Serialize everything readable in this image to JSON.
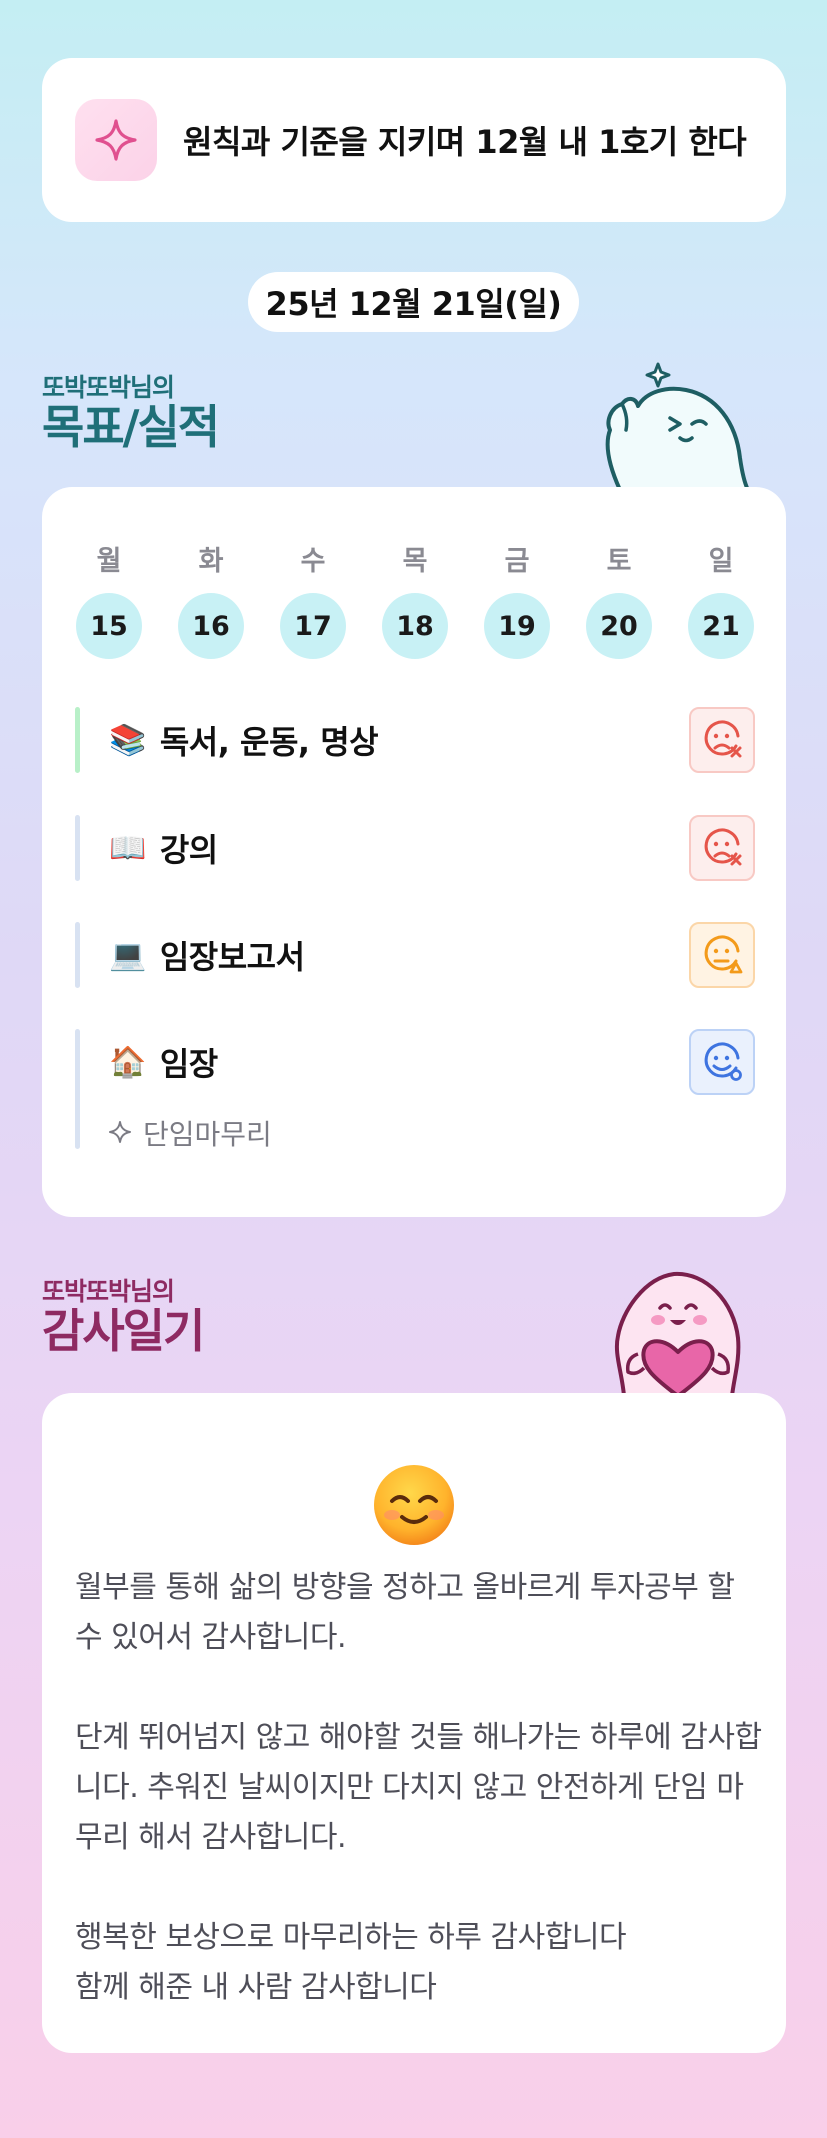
{
  "goal": {
    "icon": "sparkle-icon",
    "text": "원칙과 기준을 지키며 12월 내 1호기 한다"
  },
  "date": "25년 12월 21일(일)",
  "goals_section": {
    "title_small": "또박또박님의",
    "title_big": "목표/실적"
  },
  "week": [
    {
      "day": "월",
      "date": "15"
    },
    {
      "day": "화",
      "date": "16"
    },
    {
      "day": "수",
      "date": "17"
    },
    {
      "day": "목",
      "date": "18"
    },
    {
      "day": "금",
      "date": "19"
    },
    {
      "day": "토",
      "date": "20"
    },
    {
      "day": "일",
      "date": "21"
    }
  ],
  "goals": [
    {
      "emoji": "📚",
      "name": "독서, 운동, 명상",
      "status": "fail",
      "bar_color": "#b8f0c8"
    },
    {
      "emoji": "📖",
      "name": "강의",
      "status": "fail",
      "bar_color": "#d8e2f2"
    },
    {
      "emoji": "💻",
      "name": "임장보고서",
      "status": "partial",
      "bar_color": "#d8e2f2"
    },
    {
      "emoji": "🏠",
      "name": "임장",
      "status": "success",
      "bar_color": "#d8e2f2",
      "note": "단임마무리"
    }
  ],
  "diary_section": {
    "title_small": "또박또박님의",
    "title_big": "감사일기"
  },
  "diary": {
    "emoji": "smiling-face-icon",
    "paragraphs": [
      "월부를 통해 삶의 방향을 정하고 올바르게 투자공부 할 수 있어서 감사합니다.",
      "단계 뛰어넘지 않고 해야할 것들 해나가는 하루에 감사합니다. 추워진 날씨이지만 다치지 않고 안전하게 단임 마무리 해서 감사합니다.",
      "행복한 보상으로 마무리하는 하루 감사합니다\n함께 해준 내 사람 감사합니다"
    ]
  },
  "colors": {
    "fail": "#e5554a",
    "partial": "#f39a1a",
    "success": "#3e74e0",
    "goals_title": "#1f6f78",
    "diary_title": "#8e2a62"
  }
}
